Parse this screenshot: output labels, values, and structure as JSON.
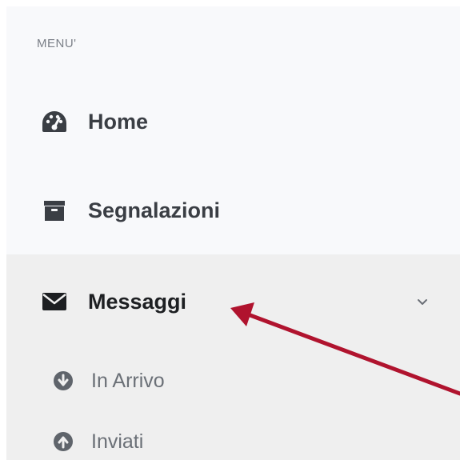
{
  "sidebar": {
    "header": "MENU'",
    "items": [
      {
        "label": "Home",
        "icon": "dashboard-icon"
      },
      {
        "label": "Segnalazioni",
        "icon": "archive-icon"
      },
      {
        "label": "Messaggi",
        "icon": "envelope-icon",
        "expanded": true,
        "children": [
          {
            "label": "In Arrivo",
            "icon": "arrow-circle-down-icon"
          },
          {
            "label": "Inviati",
            "icon": "arrow-circle-up-icon"
          }
        ]
      }
    ]
  },
  "colors": {
    "sidebar_bg": "#f8f9fb",
    "active_group_bg": "#efefef",
    "annotation_arrow": "#b0132e",
    "icon_dark": "#3a3e44",
    "sub_icon": "#5f646b"
  }
}
